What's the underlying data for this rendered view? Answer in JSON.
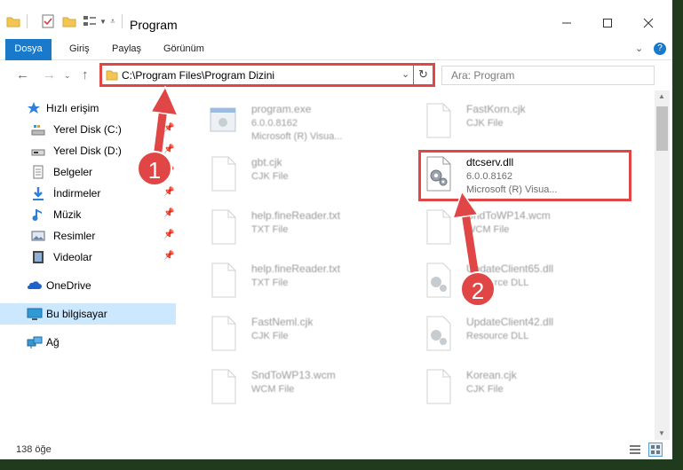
{
  "window": {
    "title": "Program"
  },
  "ribbon": {
    "tabs": [
      "Dosya",
      "Giriş",
      "Paylaş",
      "Görünüm"
    ]
  },
  "address": {
    "path": "C:\\Program Files\\Program Dizini"
  },
  "search": {
    "placeholder": "Ara: Program"
  },
  "sidebar": {
    "quick_access": "Hızlı erişim",
    "items": [
      "Yerel Disk (C:)",
      "Yerel Disk (D:)",
      "Belgeler",
      "İndirmeler",
      "Müzik",
      "Resimler",
      "Videolar"
    ],
    "onedrive": "OneDrive",
    "this_pc": "Bu bilgisayar",
    "network": "Ağ"
  },
  "files": [
    {
      "name": "program.exe",
      "line2": "6.0.0.8162",
      "line3": "Microsoft (R) Visua..."
    },
    {
      "name": "FastKorn.cjk",
      "line2": "CJK File",
      "line3": ""
    },
    {
      "name": "gbt.cjk",
      "line2": "CJK File",
      "line3": ""
    },
    {
      "name": "dtcserv.dll",
      "line2": "6.0.0.8162",
      "line3": "Microsoft (R) Visua..."
    },
    {
      "name": "help.fineReader.txt",
      "line2": "TXT File",
      "line3": ""
    },
    {
      "name": "SndToWP14.wcm",
      "line2": "WCM File",
      "line3": ""
    },
    {
      "name": "help.fineReader.txt",
      "line2": "TXT File",
      "line3": ""
    },
    {
      "name": "UpdateClient65.dll",
      "line2": "Resource DLL",
      "line3": ""
    },
    {
      "name": "FastNeml.cjk",
      "line2": "CJK File",
      "line3": ""
    },
    {
      "name": "UpdateClient42.dll",
      "line2": "Resource DLL",
      "line3": ""
    },
    {
      "name": "SndToWP13.wcm",
      "line2": "WCM File",
      "line3": ""
    },
    {
      "name": "Korean.cjk",
      "line2": "CJK File",
      "line3": ""
    }
  ],
  "status": {
    "count": "138 öğe"
  },
  "annotations": {
    "step1": "1",
    "step2": "2"
  },
  "colors": {
    "accent": "#1979ca",
    "highlight": "#e04646",
    "selection": "#cce8ff"
  }
}
